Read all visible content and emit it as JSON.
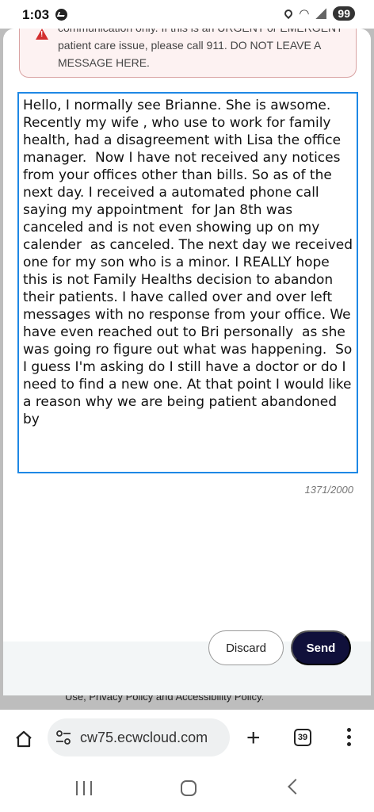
{
  "status": {
    "time": "1:03",
    "battery": "99"
  },
  "alert": {
    "text": "communication only. If this is an URGENT or EMERGENT patient care issue, please call 911. DO NOT LEAVE A MESSAGE HERE."
  },
  "message": {
    "value": "Hello, I normally see Brianne. She is awsome. Recently my wife , who use to work for family health, had a disagreement with Lisa the office manager.  Now I have not received any notices from your offices other than bills. So as of the next day. I received a automated phone call saying my appointment  for Jan 8th was canceled and is not even showing up on my calender  as canceled. The next day we received one for my son who is a minor. I REALLY hope this is not Family Healths decision to abandon their patients. I have called over and over left messages with no response from your office. We have even reached out to Bri personally  as she was going ro figure out what was happening.  So I guess I'm asking do I still have a doctor or do I need to find a new one. At that point I would like a reason why we are being patient abandoned by",
    "counter": "1371/2000"
  },
  "actions": {
    "discard_label": "Discard",
    "send_label": "Send"
  },
  "underlying": {
    "footer_text": "Use, Privacy Policy and Accessibility Policy."
  },
  "browser": {
    "url": "cw75.ecwcloud.com",
    "tab_count": "39"
  },
  "icons": [
    "home-icon",
    "site-settings-icon",
    "new-tab-plus-icon",
    "tabs-icon",
    "menu-icon",
    "recents-icon",
    "nav-home-icon",
    "back-icon",
    "alert-icon"
  ],
  "colors": {
    "send_bg": "#10103a",
    "focus_border": "#1e88e5",
    "alert_bg": "#fdf2f2",
    "alert_icon": "#d32f2f"
  }
}
